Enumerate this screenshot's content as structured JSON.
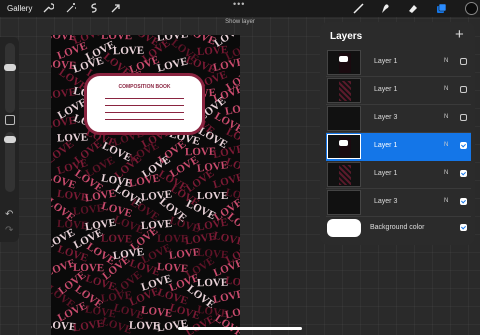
{
  "topbar": {
    "gallery_label": "Gallery",
    "center_dots": "•••"
  },
  "hint": {
    "text": "Show layer"
  },
  "canvas": {
    "label_title": "COMPOSITION BOOK",
    "pattern_word": "LOVE",
    "pattern_colors": [
      "#7a1a34",
      "#c94b6d",
      "#e9d3d9",
      "#5e1327"
    ]
  },
  "layers_panel": {
    "title": "Layers",
    "add_symbol": "+",
    "layers": [
      {
        "name": "Layer 1",
        "mode": "N",
        "visible": false,
        "active": false,
        "thumb": "white-label"
      },
      {
        "name": "Layer 1",
        "mode": "N",
        "visible": false,
        "active": false,
        "thumb": "pattern"
      },
      {
        "name": "Layer 3",
        "mode": "N",
        "visible": false,
        "active": false,
        "thumb": "dark"
      },
      {
        "name": "Layer 1",
        "mode": "N",
        "visible": true,
        "active": true,
        "thumb": "white-label"
      },
      {
        "name": "Layer 1",
        "mode": "N",
        "visible": true,
        "active": false,
        "thumb": "pattern"
      },
      {
        "name": "Layer 3",
        "mode": "N",
        "visible": true,
        "active": false,
        "thumb": "dark"
      }
    ],
    "background": {
      "label": "Background color",
      "visible": true,
      "color": "#ffffff"
    }
  },
  "colors": {
    "accent": "#1476e8",
    "label_border": "#8a2440",
    "active_color": "#0b0b0b"
  },
  "icons": [
    "wrench-icon",
    "magic-wand-icon",
    "selection-icon",
    "transform-arrow-icon",
    "brush-icon",
    "smudge-icon",
    "eraser-icon",
    "layers-icon"
  ]
}
